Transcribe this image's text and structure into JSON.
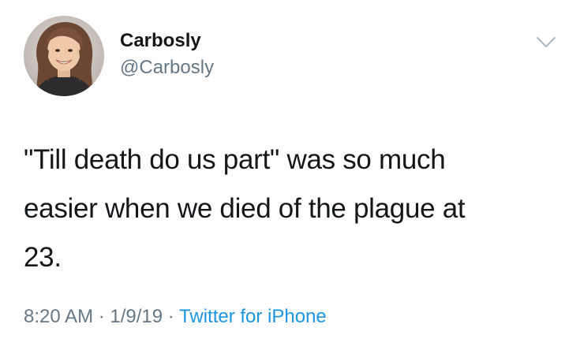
{
  "author": {
    "display_name": "Carbosly",
    "handle": "@Carbosly",
    "avatar_icon": "user-avatar"
  },
  "menu_icon": "chevron-down-icon",
  "tweet": {
    "lines": [
      "\"Till death do us part\" was so much",
      "easier when we died of the plague at",
      "23."
    ]
  },
  "meta": {
    "time": "8:20 AM",
    "separator": " · ",
    "date": "1/9/19",
    "source": "Twitter for iPhone"
  },
  "colors": {
    "text": "#14171a",
    "secondary": "#657786",
    "link": "#1b95e0"
  }
}
